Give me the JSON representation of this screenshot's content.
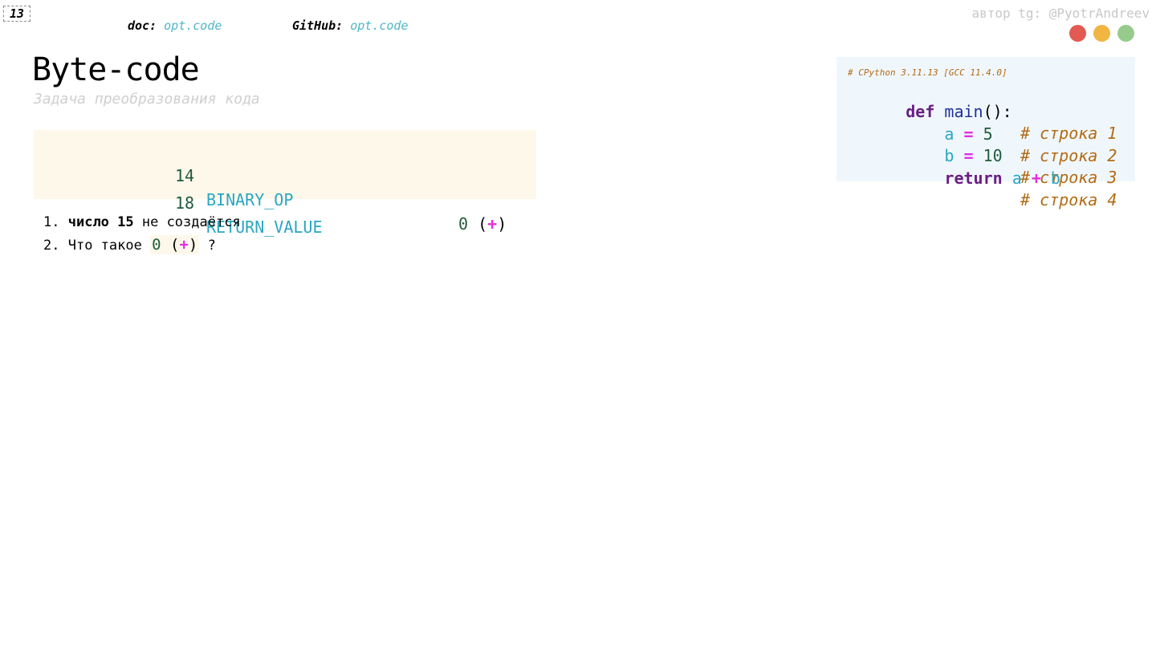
{
  "slide": {
    "number": "13"
  },
  "header": {
    "doc_label": "doc:",
    "doc_value": "opt.code",
    "github_label": "GitHub:",
    "github_value": "opt.code",
    "author": "автор tg: @PyotrAndreev"
  },
  "window_dots": {
    "colors": [
      "#e25a51",
      "#f1b542",
      "#97cb8e"
    ]
  },
  "title": "Byte-code",
  "subtitle": "Задача преобразования кода",
  "bytecode": {
    "rows": [
      {
        "offset": "14",
        "opname": "BINARY_OP",
        "arg_num": "0",
        "arg_open": "(",
        "arg_op": "+",
        "arg_close": ")"
      },
      {
        "offset": "18",
        "opname": "RETURN_VALUE"
      }
    ]
  },
  "list": {
    "items": [
      {
        "marker": "1.",
        "bold_text": "число 15",
        "text": " не создаётся"
      },
      {
        "marker": "2.",
        "text": "Что такое ",
        "code_num": "0",
        "code_open": "(",
        "code_op": "+",
        "code_close": ")",
        "tail": " ?"
      }
    ]
  },
  "code_panel": {
    "header_comment": "# CPython 3.11.13 [GCC 11.4.0]",
    "lines": [
      {
        "kw": "def",
        "name": "main",
        "punct": "():",
        "comment": "# строка 1"
      },
      {
        "var": "a",
        "op": "=",
        "val": "5",
        "comment": "# строка 2"
      },
      {
        "var": "b",
        "op": "=",
        "val": "10",
        "comment": "# строка 3"
      },
      {
        "kw": "return",
        "left": "a",
        "op": "+",
        "right": "b",
        "comment": "# строка 4"
      }
    ]
  }
}
